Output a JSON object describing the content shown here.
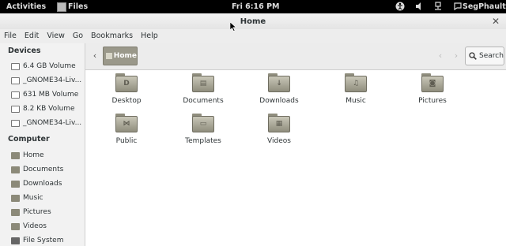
{
  "top_panel": {
    "activities": "Activities",
    "app_name": "Files",
    "clock": "Fri  6:16 PM",
    "user": "SegPhault"
  },
  "window": {
    "title": "Home",
    "menu": [
      "File",
      "Edit",
      "View",
      "Go",
      "Bookmarks",
      "Help"
    ]
  },
  "sidebar": {
    "devices_heading": "Devices",
    "devices": [
      "6.4 GB Volume",
      "_GNOME34-Liv...",
      "631 MB Volume",
      "8.2 KB Volume",
      "_GNOME34-Liv..."
    ],
    "computer_heading": "Computer",
    "computer": [
      "Home",
      "Documents",
      "Downloads",
      "Music",
      "Pictures",
      "Videos",
      "File System"
    ]
  },
  "toolbar": {
    "breadcrumb": "Home",
    "search_label": "Search"
  },
  "files": [
    {
      "name": "Desktop",
      "emblem": "desktop-icon"
    },
    {
      "name": "Documents",
      "emblem": "document-icon"
    },
    {
      "name": "Downloads",
      "emblem": "download-icon"
    },
    {
      "name": "Music",
      "emblem": "music-note-icon"
    },
    {
      "name": "Pictures",
      "emblem": "camera-icon"
    },
    {
      "name": "Public",
      "emblem": "share-icon"
    },
    {
      "name": "Templates",
      "emblem": "template-icon"
    },
    {
      "name": "Videos",
      "emblem": "film-icon"
    }
  ]
}
